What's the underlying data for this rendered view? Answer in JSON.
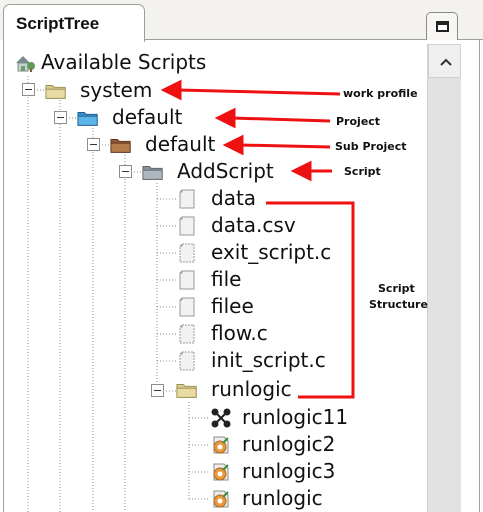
{
  "panel": {
    "tab_title": "ScriptTree",
    "window_button_icon": "restore-window-icon",
    "scroll_up_icon": "chevron-up-icon"
  },
  "tree": {
    "root": {
      "label": "Available Scripts",
      "icon": "house-tree-icon"
    },
    "work_profile": {
      "label": "system",
      "icon": "folder-icon",
      "expanded": true
    },
    "project": {
      "label": "default",
      "icon": "blue-folder-icon",
      "expanded": true
    },
    "sub_project": {
      "label": "default",
      "icon": "brown-folder-icon",
      "expanded": true
    },
    "script": {
      "label": "AddScript",
      "icon": "gray-folder-icon",
      "expanded": true
    },
    "files": [
      {
        "label": "data",
        "icon": "file-icon"
      },
      {
        "label": "data.csv",
        "icon": "file-icon"
      },
      {
        "label": "exit_script.c",
        "icon": "c-file-icon"
      },
      {
        "label": "file",
        "icon": "file-icon"
      },
      {
        "label": "filee",
        "icon": "file-icon"
      },
      {
        "label": "flow.c",
        "icon": "c-file-icon"
      },
      {
        "label": "init_script.c",
        "icon": "c-file-icon"
      }
    ],
    "runlogic_folder": {
      "label": "runlogic",
      "icon": "folder-icon",
      "expanded": true
    },
    "runlogic_items": [
      {
        "label": "runlogic11",
        "icon": "flow-network-icon"
      },
      {
        "label": "runlogic2",
        "icon": "runlogic-gear-icon"
      },
      {
        "label": "runlogic3",
        "icon": "runlogic-gear-icon"
      },
      {
        "label": "runlogic",
        "icon": "runlogic-gear-icon"
      }
    ]
  },
  "annotations": {
    "work_profile": "work profile",
    "project": "Project",
    "sub_project": "Sub Project",
    "script": "Script",
    "script_structure_line1": "Script",
    "script_structure_line2": "Structure",
    "arrow_color": "#ee1111"
  },
  "colors": {
    "tree_line": "#8a8a8a",
    "yellow_folder": "#d9cc8e",
    "blue_folder": "#4aa3dc",
    "brown_folder": "#a36a3f",
    "gray_folder": "#9aa3ad"
  }
}
